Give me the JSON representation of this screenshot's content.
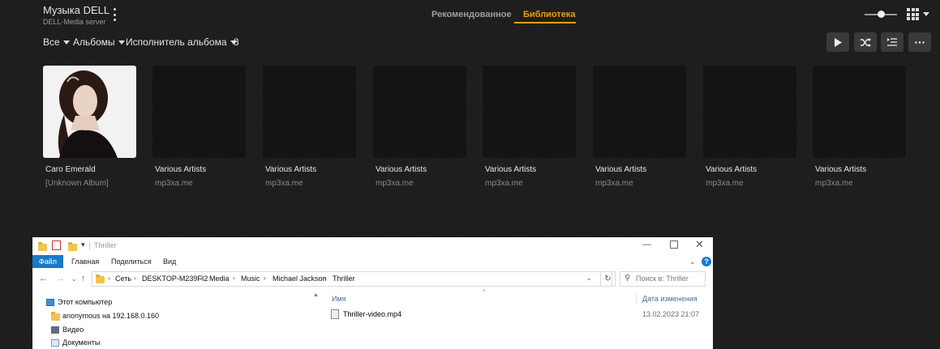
{
  "header": {
    "title": "Музыка DELL",
    "server": "DELL-Media server",
    "tabs": [
      {
        "label": "Рекомендованное",
        "active": false
      },
      {
        "label": "Библиотека",
        "active": true
      }
    ],
    "accent_color": "#e5a00d",
    "zoom_level": 0.5
  },
  "filters": {
    "all": "Все",
    "type": "Альбомы",
    "sort": "Исполнитель альбома",
    "count": "8"
  },
  "toolbar_icons": [
    "play-icon",
    "shuffle-icon",
    "queue-icon",
    "more-icon"
  ],
  "albums": [
    {
      "artist": "Caro Emerald",
      "album": "[Unknown Album]",
      "has_art": true
    },
    {
      "artist": "Various Artists",
      "album": "mp3xa.me",
      "has_art": false
    },
    {
      "artist": "Various Artists",
      "album": "mp3xa.me",
      "has_art": false
    },
    {
      "artist": "Various Artists",
      "album": "mp3xa.me",
      "has_art": false
    },
    {
      "artist": "Various Artists",
      "album": "mp3xa.me",
      "has_art": false
    },
    {
      "artist": "Various Artists",
      "album": "mp3xa.me",
      "has_art": false
    },
    {
      "artist": "Various Artists",
      "album": "mp3xa.me",
      "has_art": false
    },
    {
      "artist": "Various Artists",
      "album": "mp3xa.me",
      "has_art": false
    }
  ],
  "explorer": {
    "title": "Thriller",
    "ribbon": {
      "file": "Файл",
      "home": "Главная",
      "share": "Поделиться",
      "view": "Вид"
    },
    "path": [
      "Сеть",
      "DESKTOP-M239FI2",
      "Media",
      "Music",
      "Michael Jackson",
      "Thriller"
    ],
    "search_placeholder": "Поиск в: Thriller",
    "tree": [
      "Этот компьютер",
      "anonymous на 192.168.0.160",
      "Видео",
      "Документы"
    ],
    "columns": {
      "name": "Имя",
      "date": "Дата изменения"
    },
    "files": [
      {
        "name": "Thriller-video.mp4",
        "date": "13.02.2023 21:07"
      }
    ]
  }
}
